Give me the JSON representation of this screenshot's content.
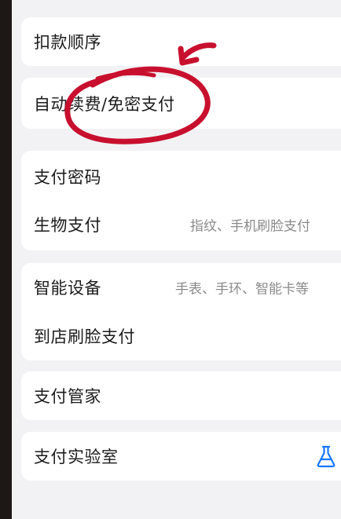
{
  "settings": {
    "deduction_order": "扣款顺序",
    "auto_renew": "自动续费/免密支付",
    "payment_password": "支付密码",
    "biometric_payment": "生物支付",
    "biometric_value": "指纹、手机刷脸支付",
    "smart_devices": "智能设备",
    "smart_devices_value": "手表、手环、智能卡等",
    "in_store_face_pay": "到店刷脸支付",
    "payment_butler": "支付管家",
    "payment_lab": "支付实验室"
  },
  "icons": {
    "lab": "flask-icon"
  },
  "colors": {
    "annotation_red": "#c8102e",
    "lab_icon_blue": "#1677ff"
  }
}
